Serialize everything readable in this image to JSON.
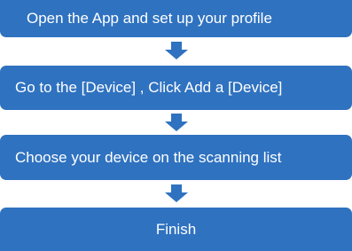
{
  "flow": {
    "steps": [
      {
        "label": "Open the App and set up your profile"
      },
      {
        "label": "Go to the [Device] , Click Add a [Device]"
      },
      {
        "label": "Choose your device on the scanning list"
      },
      {
        "label": "Finish"
      }
    ],
    "box_color": "#2f72c0",
    "arrow_color": "#2f72c0",
    "arrow_icon": "down-arrow-icon"
  }
}
